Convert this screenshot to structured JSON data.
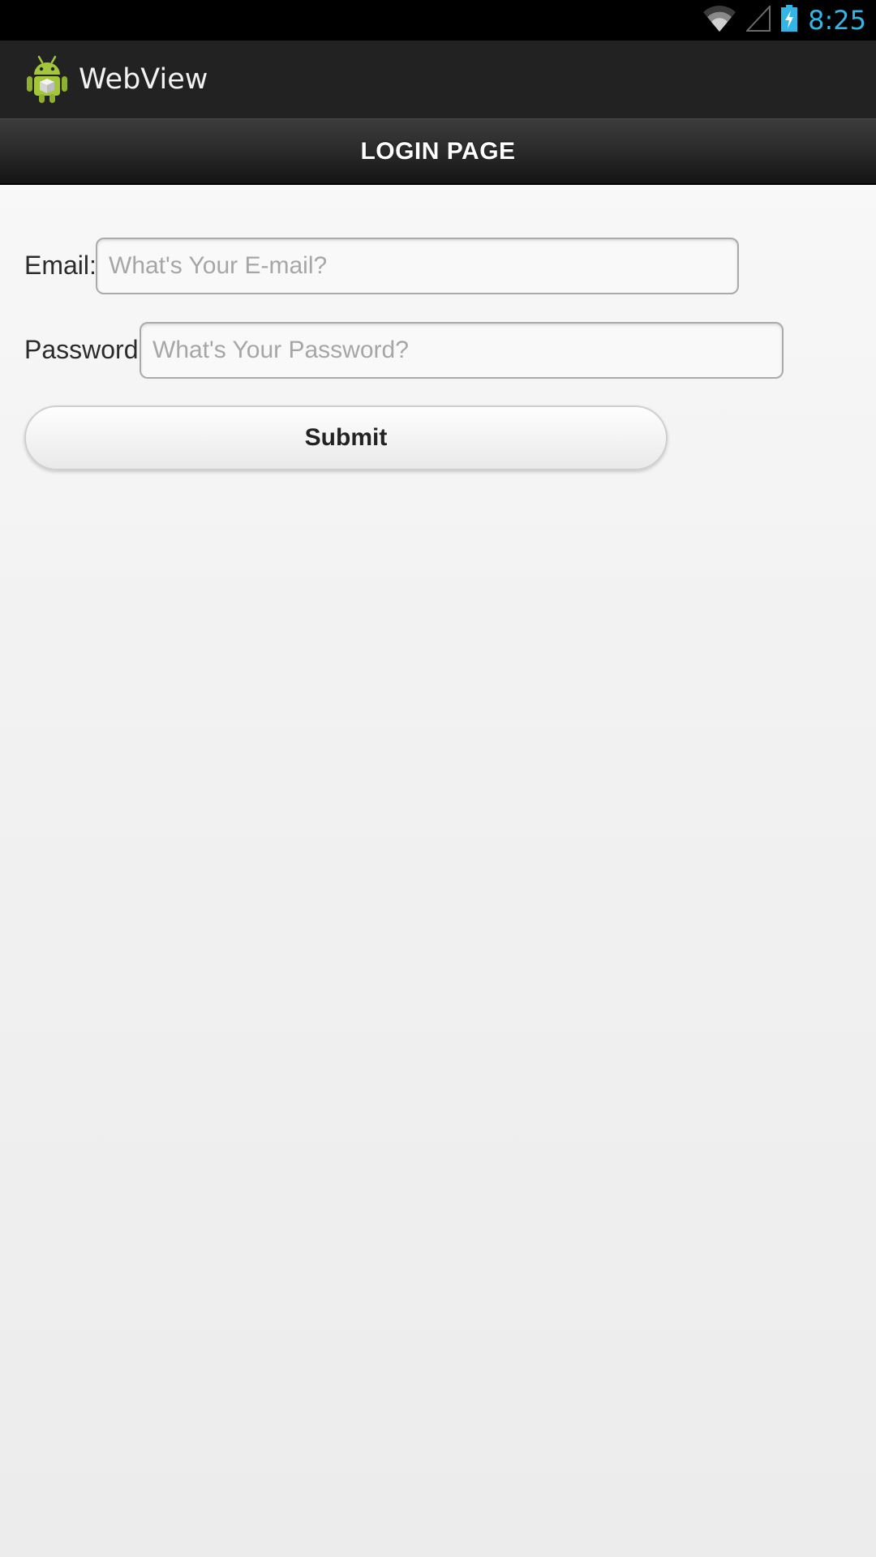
{
  "status_bar": {
    "time": "8:25",
    "icons": [
      "wifi-icon",
      "cell-signal-icon",
      "battery-charging-icon"
    ],
    "time_color": "#33b5e5"
  },
  "action_bar": {
    "app_icon": "android-app-icon",
    "title": "WebView"
  },
  "page_header": {
    "title": "LOGIN PAGE"
  },
  "form": {
    "email_label": "Email:",
    "email_placeholder": "What's Your E-mail?",
    "email_value": "",
    "password_label": "Password",
    "password_placeholder": "What's Your Password?",
    "password_value": "",
    "submit_label": "Submit"
  }
}
